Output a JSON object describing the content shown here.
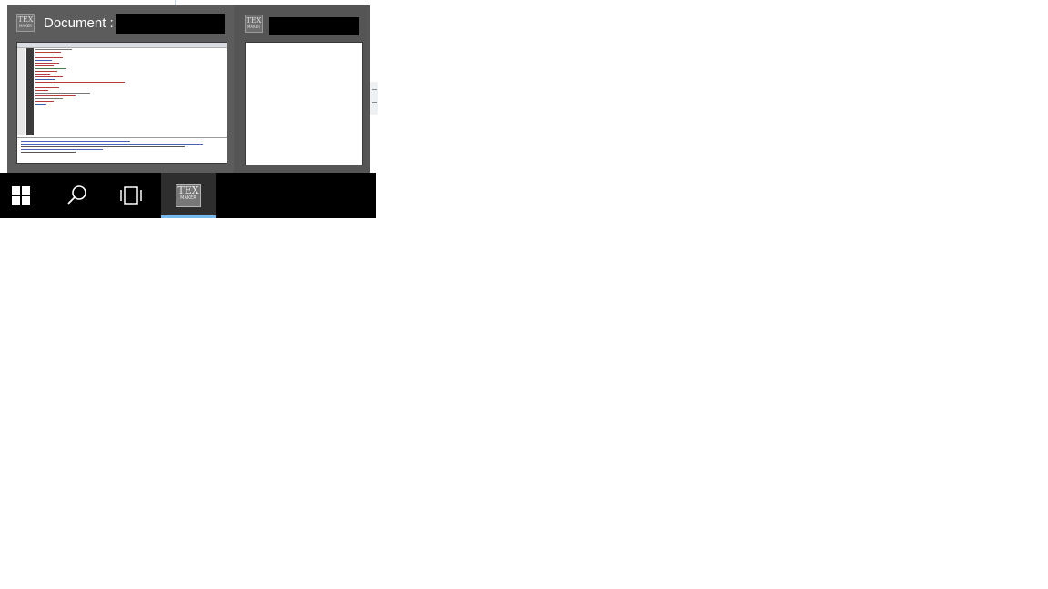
{
  "background": {
    "color": "#ffffff"
  },
  "flyout": {
    "active_window": {
      "title_prefix": "Document :",
      "icon": "texmaker-app-icon",
      "icon_text": "TEX",
      "icon_subtext": "MAKER",
      "title_redacted": true
    },
    "second_window": {
      "icon": "texmaker-app-icon",
      "icon_text": "TEX",
      "icon_subtext": "MAKER",
      "title_redacted": true
    }
  },
  "taskbar": {
    "start": {
      "icon": "windows-logo-icon"
    },
    "search": {
      "icon": "search-icon"
    },
    "task_view": {
      "icon": "task-view-icon"
    },
    "app": {
      "icon": "texmaker-app-icon",
      "icon_text": "TEX",
      "icon_subtext": "MAKER",
      "active_indicator_color": "#76b9ed"
    }
  },
  "colors": {
    "taskbar": "#000000",
    "flyout": "#555555",
    "accent": "#76b9ed"
  }
}
